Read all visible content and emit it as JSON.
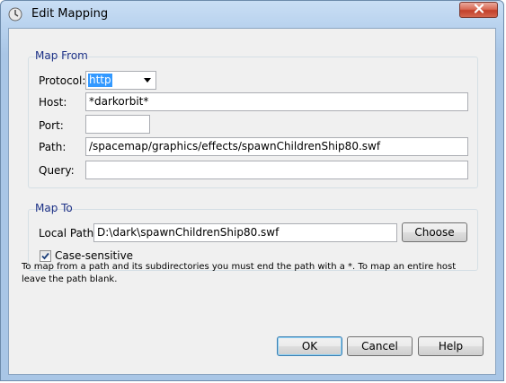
{
  "window": {
    "title": "Edit Mapping",
    "icons": {
      "app": "app-icon",
      "close": "close-icon"
    }
  },
  "map_from": {
    "title": "Map From",
    "protocol_label": "Protocol:",
    "protocol_value": "http",
    "host_label": "Host:",
    "host_value": "*darkorbit*",
    "port_label": "Port:",
    "port_value": "",
    "path_label": "Path:",
    "path_value": "/spacemap/graphics/effects/spawnChildrenShip80.swf",
    "query_label": "Query:",
    "query_value": ""
  },
  "map_to": {
    "title": "Map To",
    "local_path_label": "Local Path:",
    "local_path_value": "D:\\dark\\spawnChildrenShip80.swf",
    "choose_label": "Choose",
    "case_sensitive_label": "Case-sensitive",
    "case_sensitive_checked": true
  },
  "note": "To map from a path and its subdirectories you must end the path with a *. To map an entire host leave the path blank.",
  "buttons": {
    "ok": "OK",
    "cancel": "Cancel",
    "help": "Help"
  }
}
